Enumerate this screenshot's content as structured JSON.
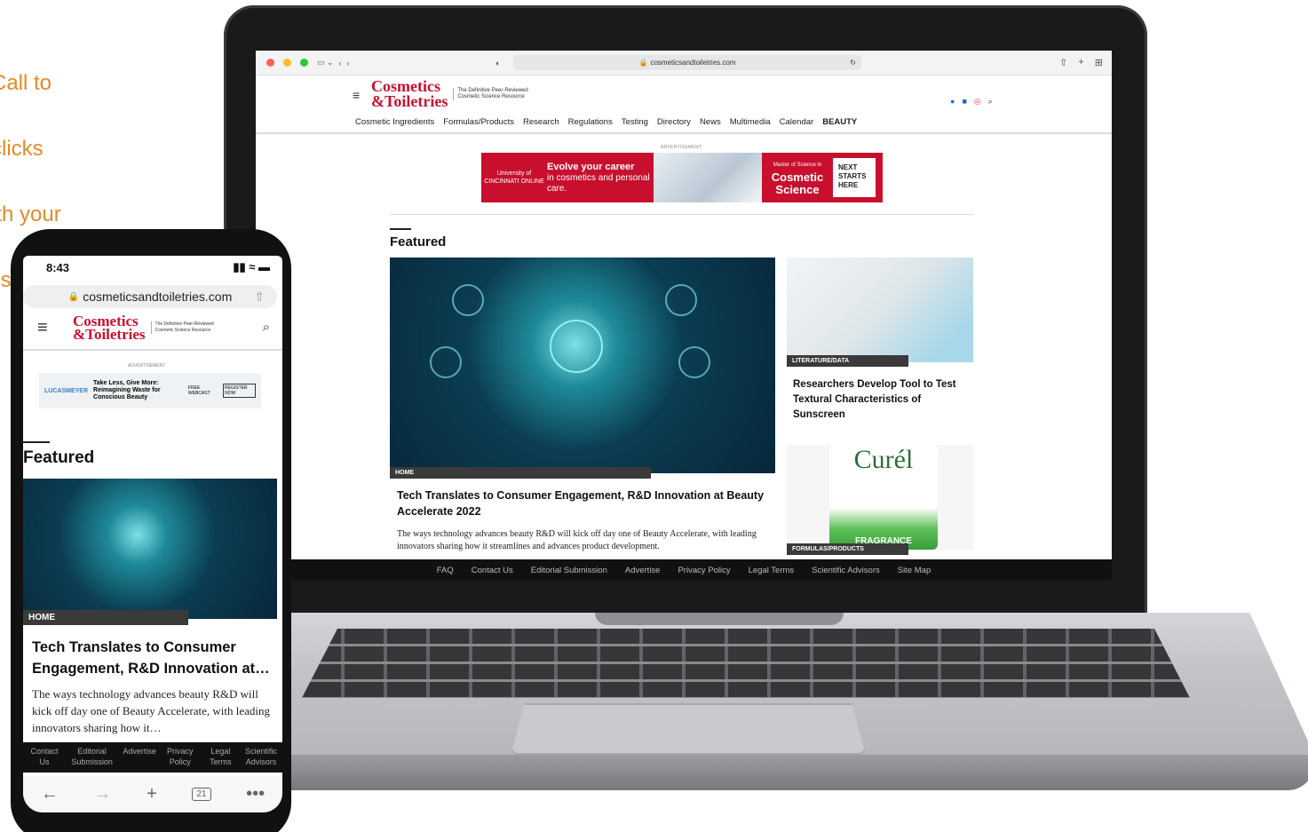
{
  "side_copy": [
    "Call to",
    "clicks",
    "ith your",
    "ils"
  ],
  "laptop": {
    "url": "cosmeticsandtoiletries.com",
    "logo": {
      "line1": "Cosmetics",
      "line2": "&Toiletries",
      "tagline": "The Definitive Peer-Reviewed Cosmetic Science Resource"
    },
    "nav": [
      "Cosmetic Ingredients",
      "Formulas/Products",
      "Research",
      "Regulations",
      "Testing",
      "Directory",
      "News",
      "Multimedia",
      "Calendar",
      "BEAUTY"
    ],
    "ad": {
      "label": "ADVERTISEMENT",
      "school": "University of CINCINNATI ONLINE",
      "headline": "Evolve your career",
      "sub": "in cosmetics and personal care.",
      "program_small": "Master of Science in",
      "program": "Cosmetic Science",
      "cta": "NEXT STARTS HERE"
    },
    "featured_heading": "Featured",
    "hero": {
      "tag": "HOME",
      "title": "Tech Translates to Consumer Engagement, R&D Innovation at Beauty Accelerate 2022",
      "desc": "The ways technology advances beauty R&D will kick off day one of Beauty Accelerate, with leading innovators sharing how it streamlines and advances product development."
    },
    "card1": {
      "tag": "LITERATURE/DATA",
      "title": "Researchers Develop Tool to Test Textural Characteristics of Sunscreen"
    },
    "card2": {
      "tag": "FORMULAS/PRODUCTS",
      "brand": "Curél",
      "label": "FRAGRANCE"
    },
    "footer": [
      "FAQ",
      "Contact Us",
      "Editorial Submission",
      "Advertise",
      "Privacy Policy",
      "Legal Terms",
      "Scientific Advisors",
      "Site Map"
    ]
  },
  "phone": {
    "time": "8:43",
    "url": "cosmeticsandtoiletries.com",
    "logo": {
      "line1": "Cosmetics",
      "line2": "&Toiletries",
      "tagline": "The Definitive Peer-Reviewed Cosmetic Science Resource"
    },
    "ad": {
      "label": "ADVERTISEMENT",
      "brand": "LUCASMEYER",
      "headline": "Take Less, Give More: Reimagining Waste for Conscious Beauty",
      "cta": "REGISTER NOW",
      "webcast": "FREE WEBCAST"
    },
    "featured_heading": "Featured",
    "hero": {
      "tag": "HOME",
      "title": "Tech Translates to Consumer Engagement, R&D Innovation at…",
      "desc": "The ways technology advances beauty R&D will kick off day one of Beauty Accelerate, with leading innovators sharing how it…"
    },
    "footer": [
      "Contact Us",
      "Editorial Submission",
      "Advertise",
      "Privacy Policy",
      "Legal Terms",
      "Scientific Advisors"
    ],
    "tab_count": "21"
  }
}
